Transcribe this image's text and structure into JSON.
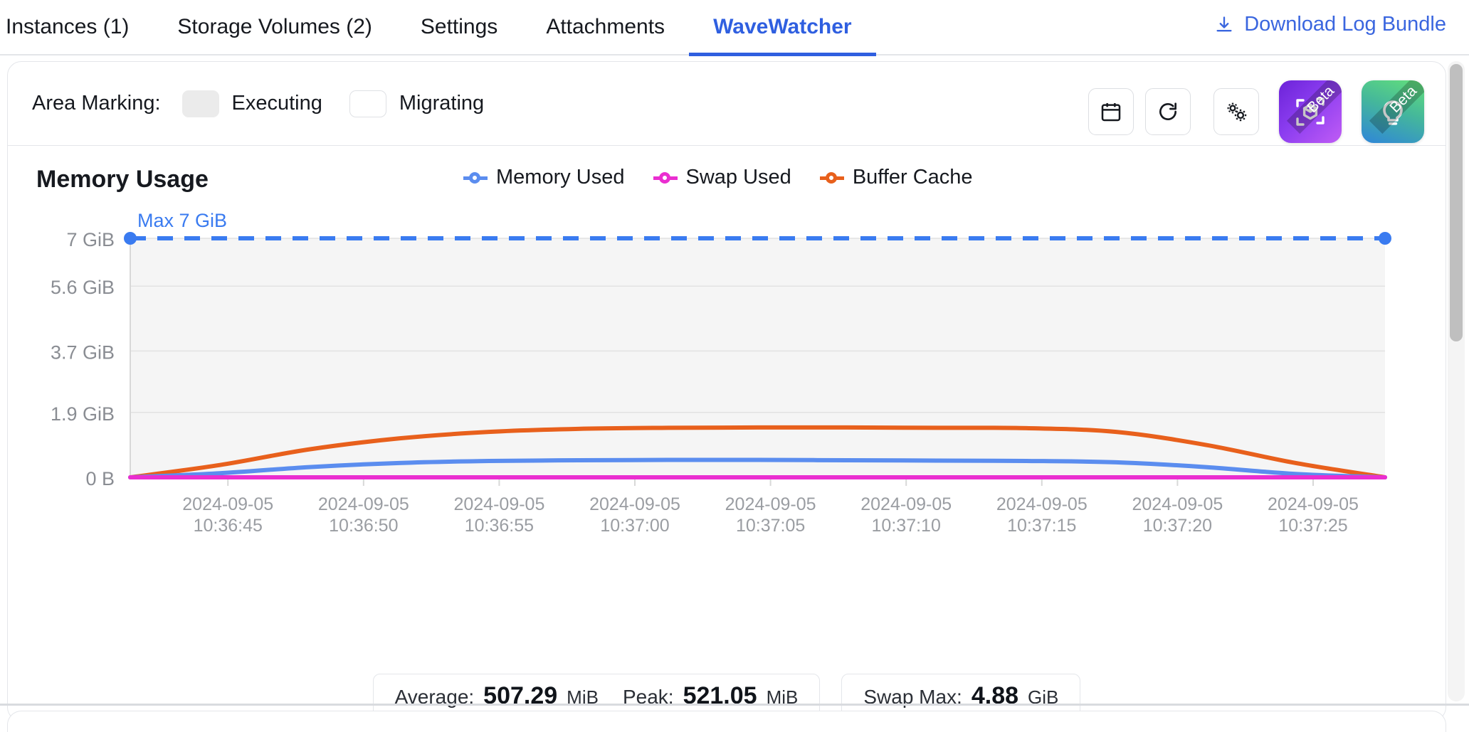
{
  "tabs": [
    {
      "label": "Instances (1)",
      "active": false
    },
    {
      "label": "Storage Volumes (2)",
      "active": false
    },
    {
      "label": "Settings",
      "active": false
    },
    {
      "label": "Attachments",
      "active": false
    },
    {
      "label": "WaveWatcher",
      "active": true
    }
  ],
  "header": {
    "download_label": "Download Log Bundle",
    "download_icon": "download-icon"
  },
  "controls": {
    "area_marking_label": "Area Marking:",
    "markings": [
      {
        "label": "Executing",
        "color": "#ebebeb"
      },
      {
        "label": "Migrating",
        "color": "#ffffff"
      }
    ],
    "buttons": [
      {
        "name": "calendar-icon",
        "badge": ""
      },
      {
        "name": "refresh-icon",
        "badge": ""
      },
      {
        "name": "settings-gears-icon",
        "badge": ""
      },
      {
        "name": "3d-cube-scan-icon",
        "badge": "Beta"
      },
      {
        "name": "lightbulb-icon",
        "badge": "Beta"
      }
    ]
  },
  "chart_data": {
    "type": "line",
    "title": "Memory Usage",
    "xlabel": "",
    "ylabel": "",
    "grid": true,
    "legend_position": "top-center",
    "ytick_labels": [
      "7 GiB",
      "5.6 GiB",
      "3.7 GiB",
      "1.9 GiB",
      "0 B"
    ],
    "ytick_values": [
      7,
      5.6,
      3.7,
      1.9,
      0
    ],
    "ylim": [
      0,
      7
    ],
    "yunit": "GiB",
    "threshold": {
      "label": "Max 7 GiB",
      "value": 7,
      "color": "#3a7bf0",
      "style": "dashed"
    },
    "x": [
      "2024-09-05 10:36:45",
      "2024-09-05 10:36:50",
      "2024-09-05 10:36:55",
      "2024-09-05 10:37:00",
      "2024-09-05 10:37:05",
      "2024-09-05 10:37:10",
      "2024-09-05 10:37:15",
      "2024-09-05 10:37:20",
      "2024-09-05 10:37:25"
    ],
    "xtick_labels": [
      "2024-09-05\n10:36:45",
      "2024-09-05\n10:36:50",
      "2024-09-05\n10:36:55",
      "2024-09-05\n10:37:00",
      "2024-09-05\n10:37:05",
      "2024-09-05\n10:37:10",
      "2024-09-05\n10:37:15",
      "2024-09-05\n10:37:20",
      "2024-09-05\n10:37:25"
    ],
    "series": [
      {
        "name": "Memory Used",
        "color": "#5b8def",
        "values": [
          0.0,
          0.12,
          0.3,
          0.42,
          0.48,
          0.5,
          0.51,
          0.51,
          0.5,
          0.49,
          0.48,
          0.44,
          0.3,
          0.1,
          0.0
        ]
      },
      {
        "name": "Swap Used",
        "color": "#ea2ed0",
        "values": [
          0.0,
          0.0,
          0.0,
          0.0,
          0.0,
          0.0,
          0.0,
          0.0,
          0.0,
          0.0,
          0.0,
          0.0,
          0.0,
          0.0,
          0.0
        ]
      },
      {
        "name": "Buffer Cache",
        "color": "#e8601c",
        "values": [
          0.0,
          0.36,
          0.82,
          1.14,
          1.33,
          1.42,
          1.45,
          1.46,
          1.46,
          1.45,
          1.44,
          1.33,
          0.95,
          0.42,
          0.0
        ]
      }
    ]
  },
  "stats": {
    "group_a": [
      {
        "label": "Average:",
        "value": "507.29",
        "unit": "MiB"
      },
      {
        "label": "Peak:",
        "value": "521.05",
        "unit": "MiB"
      }
    ],
    "group_b": [
      {
        "label": "Swap Max:",
        "value": "4.88",
        "unit": "GiB"
      }
    ]
  },
  "colors": {
    "accent": "#2f5fe0",
    "memory_used": "#5b8def",
    "swap_used": "#ea2ed0",
    "buffer_cache": "#e8601c",
    "threshold": "#3a7bf0"
  }
}
